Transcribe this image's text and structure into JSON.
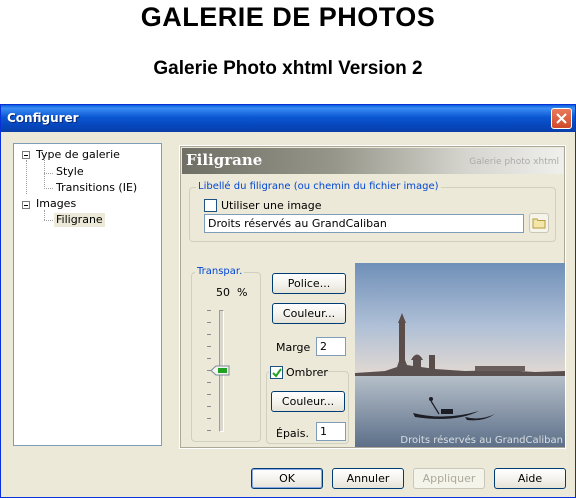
{
  "page": {
    "heading": "GALERIE DE PHOTOS",
    "subheading": "Galerie Photo xhtml Version 2"
  },
  "window": {
    "title": "Configurer",
    "close_icon": "close-icon"
  },
  "tree": {
    "root1": "Type de galerie",
    "child_style": "Style",
    "child_transitions": "Transitions (IE)",
    "root2": "Images",
    "child_filigrane": "Filigrane",
    "selected": "Filigrane"
  },
  "panel": {
    "title": "Filigrane",
    "subtitle": "Galerie photo xhtml",
    "label_group": {
      "legend": "Libellé du filigrane (ou chemin du fichier image)",
      "use_image_label": "Utiliser une image",
      "use_image_checked": false,
      "text_value": "Droits réservés au GrandCaliban",
      "browse_icon": "folder-icon"
    },
    "transparency": {
      "legend": "Transpar.",
      "value": "50",
      "unit": "%",
      "slider_level_percent": 50
    },
    "buttons": {
      "font": "Police...",
      "color": "Couleur...",
      "shadow_color": "Couleur..."
    },
    "margin": {
      "label": "Marge",
      "value": "2"
    },
    "shadow": {
      "label": "Ombrer",
      "checked": true
    },
    "thickness": {
      "label": "Épais.",
      "value": "1"
    },
    "preview_watermark": "Droits réservés au GrandCaliban"
  },
  "footer": {
    "ok": "OK",
    "cancel": "Annuler",
    "apply": "Appliquer",
    "help": "Aide"
  },
  "colors": {
    "titlebar": "#0a56d0",
    "legend_text": "#0046d5",
    "dialog_bg": "#ece9d8"
  }
}
